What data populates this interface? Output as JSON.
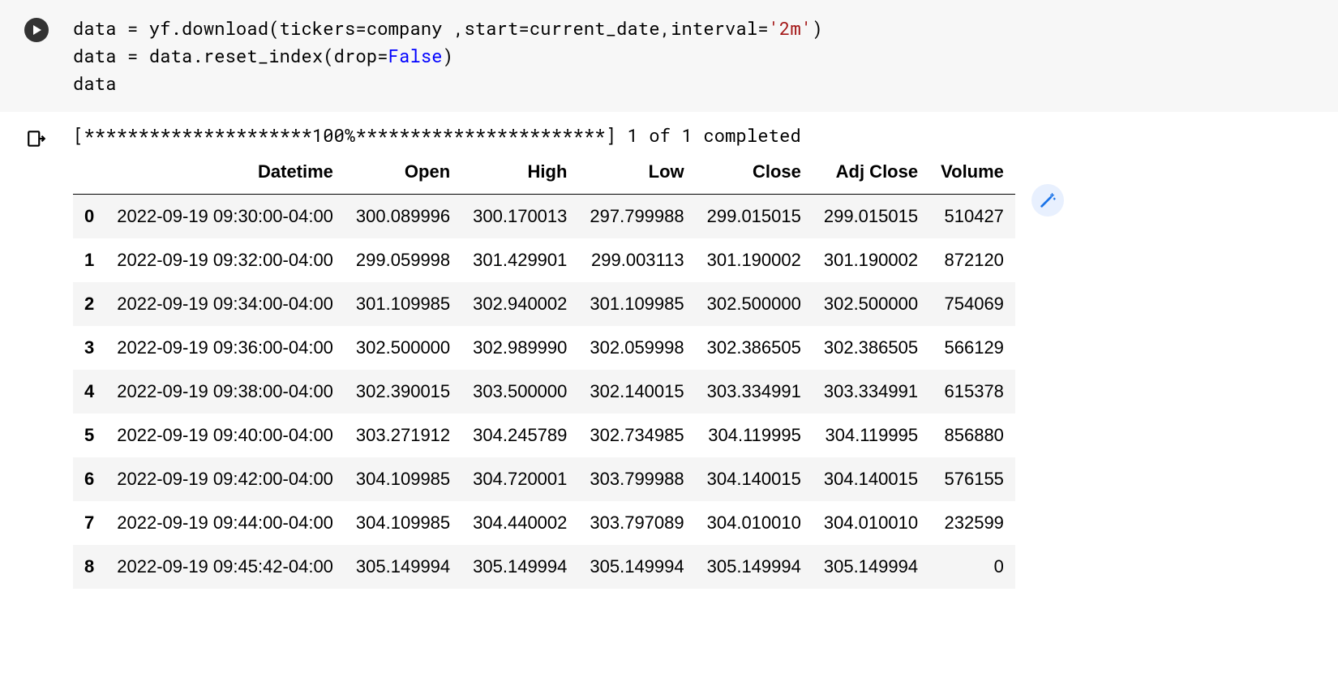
{
  "code": {
    "line1": {
      "pre": "data = yf.download(tickers=company ,start=current_date,interval=",
      "str": "'2m'",
      "post": ")"
    },
    "line2": {
      "pre": "data = data.reset_index(drop=",
      "kw": "False",
      "post": ")"
    },
    "line3": "data"
  },
  "output": {
    "progress": "[*********************100%***********************]  1 of 1 completed"
  },
  "dataframe": {
    "columns": [
      "Datetime",
      "Open",
      "High",
      "Low",
      "Close",
      "Adj Close",
      "Volume"
    ],
    "index": [
      "0",
      "1",
      "2",
      "3",
      "4",
      "5",
      "6",
      "7",
      "8"
    ],
    "rows": [
      [
        "2022-09-19 09:30:00-04:00",
        "300.089996",
        "300.170013",
        "297.799988",
        "299.015015",
        "299.015015",
        "510427"
      ],
      [
        "2022-09-19 09:32:00-04:00",
        "299.059998",
        "301.429901",
        "299.003113",
        "301.190002",
        "301.190002",
        "872120"
      ],
      [
        "2022-09-19 09:34:00-04:00",
        "301.109985",
        "302.940002",
        "301.109985",
        "302.500000",
        "302.500000",
        "754069"
      ],
      [
        "2022-09-19 09:36:00-04:00",
        "302.500000",
        "302.989990",
        "302.059998",
        "302.386505",
        "302.386505",
        "566129"
      ],
      [
        "2022-09-19 09:38:00-04:00",
        "302.390015",
        "303.500000",
        "302.140015",
        "303.334991",
        "303.334991",
        "615378"
      ],
      [
        "2022-09-19 09:40:00-04:00",
        "303.271912",
        "304.245789",
        "302.734985",
        "304.119995",
        "304.119995",
        "856880"
      ],
      [
        "2022-09-19 09:42:00-04:00",
        "304.109985",
        "304.720001",
        "303.799988",
        "304.140015",
        "304.140015",
        "576155"
      ],
      [
        "2022-09-19 09:44:00-04:00",
        "304.109985",
        "304.440002",
        "303.797089",
        "304.010010",
        "304.010010",
        "232599"
      ],
      [
        "2022-09-19 09:45:42-04:00",
        "305.149994",
        "305.149994",
        "305.149994",
        "305.149994",
        "305.149994",
        "0"
      ]
    ]
  },
  "chart_data": {
    "type": "table",
    "title": "DataFrame output",
    "columns": [
      "Datetime",
      "Open",
      "High",
      "Low",
      "Close",
      "Adj Close",
      "Volume"
    ],
    "index": [
      0,
      1,
      2,
      3,
      4,
      5,
      6,
      7,
      8
    ],
    "rows": [
      [
        "2022-09-19 09:30:00-04:00",
        300.089996,
        300.170013,
        297.799988,
        299.015015,
        299.015015,
        510427
      ],
      [
        "2022-09-19 09:32:00-04:00",
        299.059998,
        301.429901,
        299.003113,
        301.190002,
        301.190002,
        872120
      ],
      [
        "2022-09-19 09:34:00-04:00",
        301.109985,
        302.940002,
        301.109985,
        302.5,
        302.5,
        754069
      ],
      [
        "2022-09-19 09:36:00-04:00",
        302.5,
        302.98999,
        302.059998,
        302.386505,
        302.386505,
        566129
      ],
      [
        "2022-09-19 09:38:00-04:00",
        302.390015,
        303.5,
        302.140015,
        303.334991,
        303.334991,
        615378
      ],
      [
        "2022-09-19 09:40:00-04:00",
        303.271912,
        304.245789,
        302.734985,
        304.119995,
        304.119995,
        856880
      ],
      [
        "2022-09-19 09:42:00-04:00",
        304.109985,
        304.720001,
        303.799988,
        304.140015,
        304.140015,
        576155
      ],
      [
        "2022-09-19 09:44:00-04:00",
        304.109985,
        304.440002,
        303.797089,
        304.01001,
        304.01001,
        232599
      ],
      [
        "2022-09-19 09:45:42-04:00",
        305.149994,
        305.149994,
        305.149994,
        305.149994,
        305.149994,
        0
      ]
    ]
  }
}
